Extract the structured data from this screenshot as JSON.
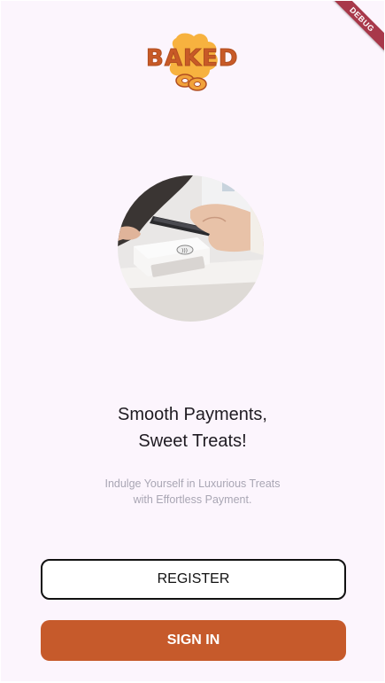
{
  "app": {
    "debug_banner": "DEBUG",
    "logo_text": "BAKED"
  },
  "hero": {
    "image_icon": "contactless-payment-illustration"
  },
  "headline": {
    "line1": "Smooth Payments,",
    "line2": "Sweet Treats!"
  },
  "subtitle": {
    "line1": "Indulge Yourself in Luxurious Treats",
    "line2": "with Effortless Payment."
  },
  "actions": {
    "register_label": "REGISTER",
    "signin_label": "SIGN IN"
  },
  "colors": {
    "background": "#fcf5fd",
    "accent": "#c65a2b",
    "debug_ribbon": "#a8384a",
    "logo_blob": "#f7b23f"
  }
}
